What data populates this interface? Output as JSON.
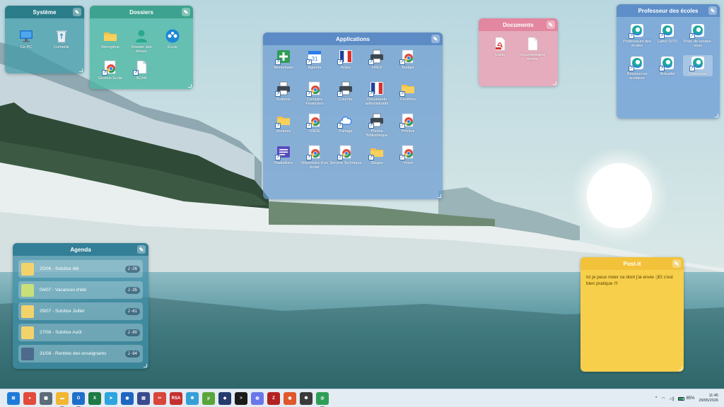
{
  "screen": {
    "width": 1024,
    "height": 576
  },
  "fences": {
    "systeme": {
      "title": "Système",
      "color": "#3f9aa6",
      "items": [
        {
          "label": "Ce PC",
          "icon": "monitor-icon"
        },
        {
          "label": "Corbeille",
          "icon": "recycle-bin-icon"
        }
      ]
    },
    "dossiers": {
      "title": "Dossiers",
      "color": "#4cb8a4",
      "items": [
        {
          "label": "Rétrogêne",
          "icon": "folder-icon"
        },
        {
          "label": "Dossier des élèves",
          "icon": "user-icon"
        },
        {
          "label": "École",
          "icon": "network-icon"
        },
        {
          "label": "Gestion École",
          "icon": "chrome-icon"
        },
        {
          "label": "SCAN",
          "icon": "file-icon"
        }
      ]
    },
    "applications": {
      "title": "Applications",
      "color": "#6a9ad0",
      "items": [
        {
          "label": "Alimentaire",
          "icon": "plus-icon"
        },
        {
          "label": "Agenda",
          "icon": "calendar-icon"
        },
        {
          "label": "Actes",
          "icon": "gov-flag-icon"
        },
        {
          "label": "FRED",
          "icon": "printer-icon"
        },
        {
          "label": "Budget",
          "icon": "chrome-icon"
        },
        {
          "label": "Scanner",
          "icon": "printer-icon"
        },
        {
          "label": "Comptes Financiers",
          "icon": "chrome-icon"
        },
        {
          "label": "Courrier",
          "icon": "printer-icon"
        },
        {
          "label": "Documents administratifs",
          "icon": "gov-flag-icon"
        },
        {
          "label": "Fenêtres",
          "icon": "folder-icon"
        },
        {
          "label": "Horaires",
          "icon": "folder-icon"
        },
        {
          "label": "ONDE",
          "icon": "chrome-icon"
        },
        {
          "label": "Partage",
          "icon": "cloud-icon"
        },
        {
          "label": "Photos Bibliothèque",
          "icon": "printer-icon"
        },
        {
          "label": "Primtux",
          "icon": "chrome-icon"
        },
        {
          "label": "Radiations",
          "icon": "list-icon"
        },
        {
          "label": "Répertoire d'un école",
          "icon": "chrome-icon"
        },
        {
          "label": "Service Technique",
          "icon": "chrome-icon"
        },
        {
          "label": "Stages",
          "icon": "folder-icon"
        },
        {
          "label": "Voxel",
          "icon": "chrome-icon"
        }
      ]
    },
    "documents": {
      "title": "Documents",
      "color": "#ee9fb2",
      "items": [
        {
          "label": "Guide",
          "icon": "pdf-icon"
        },
        {
          "label": "Documentation Année",
          "icon": "file-icon"
        }
      ]
    },
    "professeur": {
      "title": "Professeur des écoles",
      "color": "#6f9fd6",
      "items": [
        {
          "label": "Professeurs des écoles",
          "icon": "edge-icon"
        },
        {
          "label": "Label ISTO",
          "icon": "edge-icon"
        },
        {
          "label": "Prise de rendez-vous",
          "icon": "edge-icon"
        },
        {
          "label": "Ressources scolaires",
          "icon": "edge-icon"
        },
        {
          "label": "Actualité",
          "icon": "edge-icon"
        },
        {
          "label": "Connexion",
          "icon": "edge-icon"
        }
      ]
    },
    "agenda": {
      "title": "Agenda",
      "color": "#3f8fa8",
      "events": [
        {
          "text": "25/06 - Solstice été",
          "count": "J -26",
          "thumb": "#f2d36b"
        },
        {
          "text": "04/07 - Vacances d'été",
          "count": "J -35",
          "thumb": "#c9df7a"
        },
        {
          "text": "29/07 - Solstice Juillet",
          "count": "J -61",
          "thumb": "#f2d36b"
        },
        {
          "text": "27/08 - Solstice Août",
          "count": "J -90",
          "thumb": "#f2d36b"
        },
        {
          "text": "31/08 - Rentrée des enseignants",
          "count": "J -94",
          "thumb": "#4b6a8c"
        }
      ]
    },
    "postit": {
      "title": "Post-it",
      "color": "#f7cf4a",
      "text": "Ici je peux noter ce dont j'ai envie :)Et c'est bien pratique !!!"
    }
  },
  "taskbar": {
    "apps": [
      {
        "name": "windows-start-icon",
        "color": "#1f7bd8",
        "glyph": "⊞",
        "running": false
      },
      {
        "name": "app-red-icon",
        "color": "#e24b3b",
        "glyph": "●",
        "running": false
      },
      {
        "name": "calculator-icon",
        "color": "#5c6b78",
        "glyph": "▦",
        "running": false
      },
      {
        "name": "file-explorer-icon",
        "color": "#f2b632",
        "glyph": "▬",
        "running": true
      },
      {
        "name": "outlook-icon",
        "color": "#1e6fc9",
        "glyph": "O",
        "running": true
      },
      {
        "name": "excel-icon",
        "color": "#1e7b45",
        "glyph": "X",
        "running": false
      },
      {
        "name": "telegram-icon",
        "color": "#2ea4e0",
        "glyph": "➤",
        "running": false
      },
      {
        "name": "firefox-icon",
        "color": "#1f66c2",
        "glyph": "◉",
        "running": false
      },
      {
        "name": "app-doc-icon",
        "color": "#3b4b8f",
        "glyph": "▤",
        "running": false
      },
      {
        "name": "snip-icon",
        "color": "#d8453b",
        "glyph": "✂",
        "running": false
      },
      {
        "name": "rsa-icon",
        "color": "#c43030",
        "glyph": "RSA",
        "running": false
      },
      {
        "name": "pinwheel-icon",
        "color": "#35a0d6",
        "glyph": "✱",
        "running": false
      },
      {
        "name": "utorrent-icon",
        "color": "#5aa53a",
        "glyph": "µ",
        "running": false
      },
      {
        "name": "app-dark-blue-icon",
        "color": "#243a6e",
        "glyph": "◆",
        "running": false
      },
      {
        "name": "terminal-icon",
        "color": "#1b1b1b",
        "glyph": ">",
        "running": false
      },
      {
        "name": "app-chat-icon",
        "color": "#6a76e8",
        "glyph": "◍",
        "running": false
      },
      {
        "name": "filezilla-icon",
        "color": "#b32222",
        "glyph": "Z",
        "running": false
      },
      {
        "name": "firefox-2-icon",
        "color": "#e0572b",
        "glyph": "◉",
        "running": false
      },
      {
        "name": "chatgpt-icon",
        "color": "#3a3a3a",
        "glyph": "✺",
        "running": false
      },
      {
        "name": "chrome-icon",
        "color": "#2f9d57",
        "glyph": "◎",
        "running": true
      }
    ],
    "tray": {
      "battery": "85%",
      "time": "11:45",
      "date": "29/05/2026"
    }
  }
}
